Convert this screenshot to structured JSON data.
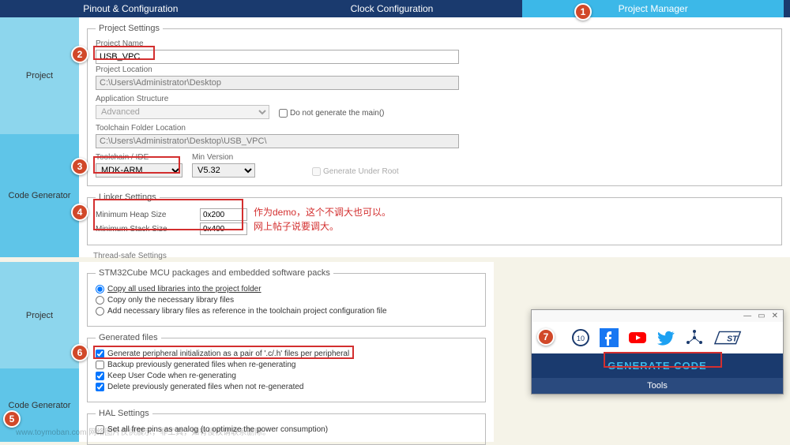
{
  "tabs": {
    "pinout": "Pinout & Configuration",
    "clock": "Clock Configuration",
    "project_manager": "Project Manager"
  },
  "sidebar": {
    "project": "Project",
    "code_generator": "Code Generator"
  },
  "project_settings": {
    "legend": "Project Settings",
    "name_label": "Project Name",
    "name_value": "USB_VPC",
    "location_label": "Project Location",
    "location_value": "C:\\Users\\Administrator\\Desktop",
    "app_structure_label": "Application Structure",
    "app_structure_value": "Advanced",
    "no_main_label": "Do not generate the main()",
    "toolchain_folder_label": "Toolchain Folder Location",
    "toolchain_folder_value": "C:\\Users\\Administrator\\Desktop\\USB_VPC\\",
    "toolchain_label": "Toolchain / IDE",
    "toolchain_value": "MDK-ARM",
    "min_version_label": "Min Version",
    "min_version_value": "V5.32",
    "gen_under_root_label": "Generate Under Root"
  },
  "linker": {
    "legend": "Linker Settings",
    "heap_label": "Minimum Heap Size",
    "heap_value": "0x200",
    "stack_label": "Minimum Stack Size",
    "stack_value": "0x400"
  },
  "anno": {
    "line1": "作为demo，这个不调大也可以。",
    "line2": "网上帖子说要调大。"
  },
  "thread_safe_label": "Thread-safe Settings",
  "packages": {
    "legend": "STM32Cube MCU packages and embedded software packs",
    "opt1": "Copy all used libraries into the project folder",
    "opt2": "Copy only the necessary library files",
    "opt3": "Add necessary library files as reference in the toolchain project configuration file"
  },
  "generated_files": {
    "legend": "Generated files",
    "opt1": "Generate peripheral initialization as a pair of '.c/.h' files per peripheral",
    "opt2": "Backup previously generated files when re-generating",
    "opt3": "Keep User Code when re-generating",
    "opt4": "Delete previously generated files when not re-generated"
  },
  "hal": {
    "legend": "HAL Settings",
    "opt1": "Set all free pins as analog (to optimize the power consumption)"
  },
  "popup": {
    "generate": "GENERATE CODE",
    "tools": "Tools"
  },
  "markers": [
    "1",
    "2",
    "3",
    "4",
    "5",
    "6",
    "7"
  ],
  "watermark": "www.toymoban.com 网络图片仅供展示，非工具，如有侵权请联系删除。"
}
